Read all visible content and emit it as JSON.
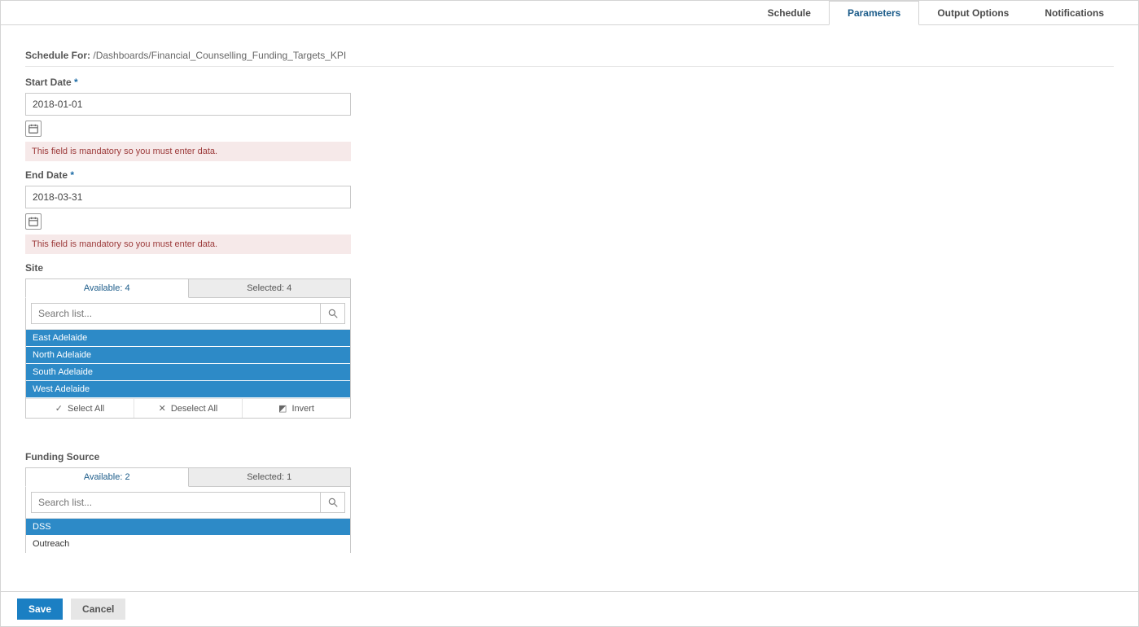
{
  "tabs": {
    "schedule": "Schedule",
    "parameters": "Parameters",
    "output_options": "Output Options",
    "notifications": "Notifications"
  },
  "schedule_for": {
    "label": "Schedule For:",
    "path": "/Dashboards/Financial_Counselling_Funding_Targets_KPI"
  },
  "start_date": {
    "label": "Start Date",
    "required_mark": "*",
    "value": "2018-01-01",
    "mandatory_msg": "This field is mandatory so you must enter data."
  },
  "end_date": {
    "label": "End Date",
    "required_mark": "*",
    "value": "2018-03-31",
    "mandatory_msg": "This field is mandatory so you must enter data."
  },
  "site": {
    "label": "Site",
    "available_tab": "Available: 4",
    "selected_tab": "Selected: 4",
    "search_placeholder": "Search list...",
    "items": [
      "East Adelaide",
      "North Adelaide",
      "South Adelaide",
      "West Adelaide"
    ],
    "actions": {
      "select_all": "Select All",
      "deselect_all": "Deselect All",
      "invert": "Invert"
    }
  },
  "funding_source": {
    "label": "Funding Source",
    "available_tab": "Available: 2",
    "selected_tab": "Selected: 1",
    "search_placeholder": "Search list...",
    "items": [
      {
        "label": "DSS",
        "selected": true
      },
      {
        "label": "Outreach",
        "selected": false
      }
    ]
  },
  "footer": {
    "save": "Save",
    "cancel": "Cancel"
  }
}
